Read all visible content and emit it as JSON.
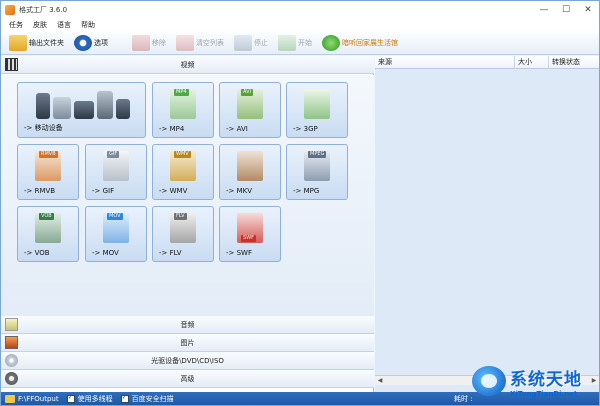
{
  "window": {
    "title": "格式工厂 3.6.0",
    "controls": [
      "—",
      "☐",
      "✕"
    ]
  },
  "menu": {
    "items": [
      "任务",
      "皮肤",
      "语言",
      "帮助"
    ]
  },
  "toolbar": {
    "items": [
      {
        "label": "输出文件夹",
        "icon": "folder-icon",
        "enabled": true
      },
      {
        "label": "选项",
        "icon": "gear-icon",
        "enabled": true
      },
      {
        "label": "移除",
        "icon": "remove-icon",
        "enabled": false
      },
      {
        "label": "清空列表",
        "icon": "clear-list-icon",
        "enabled": false
      },
      {
        "label": "停止",
        "icon": "stop-icon",
        "enabled": false
      },
      {
        "label": "开始",
        "icon": "start-icon",
        "enabled": false
      },
      {
        "label": "暗听回家展生活馆",
        "icon": "promo-icon",
        "enabled": true
      }
    ]
  },
  "categories": {
    "video": "视频",
    "audio": "音频",
    "picture": "图片",
    "rom": "光驱设备\\DVD\\CD\\ISO",
    "advanced": "高级"
  },
  "video_formats": [
    {
      "label": "-> 移动设备",
      "tag": "",
      "color": "#5a6b80"
    },
    {
      "label": "-> MP4",
      "tag": "MP4",
      "color": "#4fa84a"
    },
    {
      "label": "-> AVI",
      "tag": "AVI",
      "color": "#5aa33b"
    },
    {
      "label": "-> 3GP",
      "tag": "",
      "color": "#3f9d3a"
    },
    {
      "label": "-> RMVB",
      "tag": "RMVB",
      "color": "#d0732b"
    },
    {
      "label": "-> GIF",
      "tag": "GIF",
      "color": "#7b8a99"
    },
    {
      "label": "-> WMV",
      "tag": "WMV",
      "color": "#d7a12b"
    },
    {
      "label": "-> MKV",
      "tag": "",
      "color": "#a67a54"
    },
    {
      "label": "-> MPG",
      "tag": "MPEG",
      "color": "#5e6f86"
    },
    {
      "label": "-> VOB",
      "tag": "VOB",
      "color": "#3c7a4a"
    },
    {
      "label": "-> MOV",
      "tag": "MOV",
      "color": "#2f86d6"
    },
    {
      "label": "-> FLV",
      "tag": "FLV",
      "color": "#6f6f6f"
    },
    {
      "label": "-> SWF",
      "tag": "SWF",
      "color": "#c9302c"
    }
  ],
  "task_list": {
    "columns": [
      "来源",
      "大小",
      "转换状态"
    ]
  },
  "statusbar": {
    "output_path": "F:\\FFOutput",
    "multithread_label": "使用多线程",
    "security_scan_label": "百度安全扫描",
    "elapsed_label": "耗时 :"
  },
  "watermark": {
    "main": "系统天地",
    "sub": "XiTongTianDi.net"
  }
}
